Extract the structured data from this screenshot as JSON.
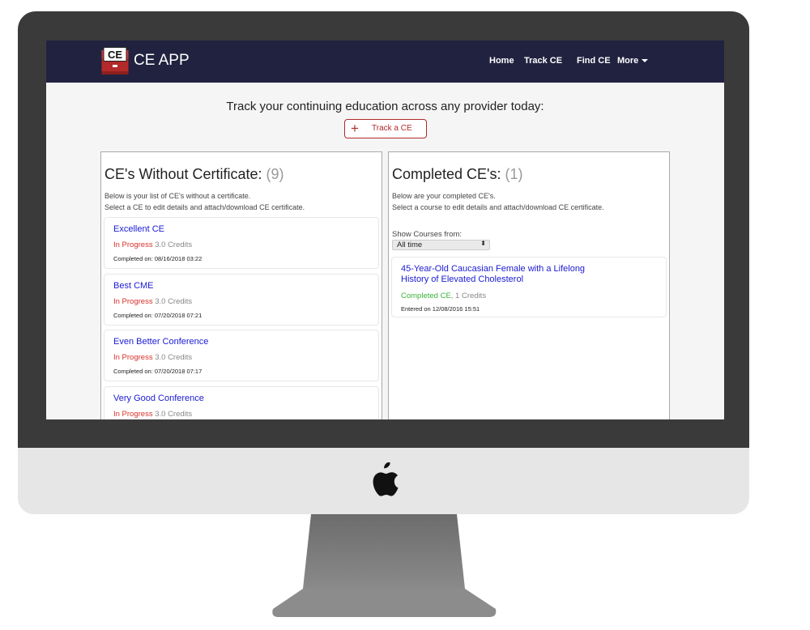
{
  "app": {
    "brand": "CE APP",
    "logo_text": "CE"
  },
  "nav": {
    "home": "Home",
    "track": "Track CE",
    "find": "Find CE",
    "more": "More"
  },
  "tagline": "Track your continuing education across any provider today:",
  "track_button": {
    "icon": "+",
    "label": "Track a CE"
  },
  "without_cert": {
    "title": "CE's Without Certificate:",
    "count": "(9)",
    "desc1": "Below is your list of CE's without a certificate.",
    "desc2": "Select a CE to edit details and attach/download CE certificate.",
    "items": [
      {
        "title": "Excellent CE",
        "status": "In Progress",
        "credits": "3.0 Credits",
        "date": "Completed on: 08/16/2018 03:22"
      },
      {
        "title": "Best CME",
        "status": "In Progress",
        "credits": "3.0 Credits",
        "date": "Completed on: 07/20/2018 07:21"
      },
      {
        "title": "Even Better Conference",
        "status": "In Progress",
        "credits": "3.0 Credits",
        "date": "Completed on: 07/20/2018 07:17"
      },
      {
        "title": "Very Good Conference",
        "status": "In Progress",
        "credits": "3.0 Credits",
        "date": ""
      }
    ]
  },
  "completed": {
    "title": "Completed CE's:",
    "count": "(1)",
    "desc1": "Below are your completed CE's.",
    "desc2": "Select a course to edit details and attach/download CE certificate.",
    "filter_label": "Show Courses from:",
    "filter_value": "All time",
    "items": [
      {
        "title": "45-Year-Old Caucasian Female with a Lifelong History of Elevated Cholesterol",
        "status": "Completed CE",
        "credits": ", 1 Credits",
        "date": "Entered on 12/08/2016 15:51"
      }
    ]
  },
  "colors": {
    "navbar": "#212240",
    "accent_red": "#b22a2a",
    "link_blue": "#1a1ad4",
    "in_progress": "#d9302b",
    "completed": "#3bb33b",
    "monitor_bezel": "#3a3a3a",
    "monitor_chin": "#e6e6e6",
    "stand": "#7d7d7d"
  }
}
